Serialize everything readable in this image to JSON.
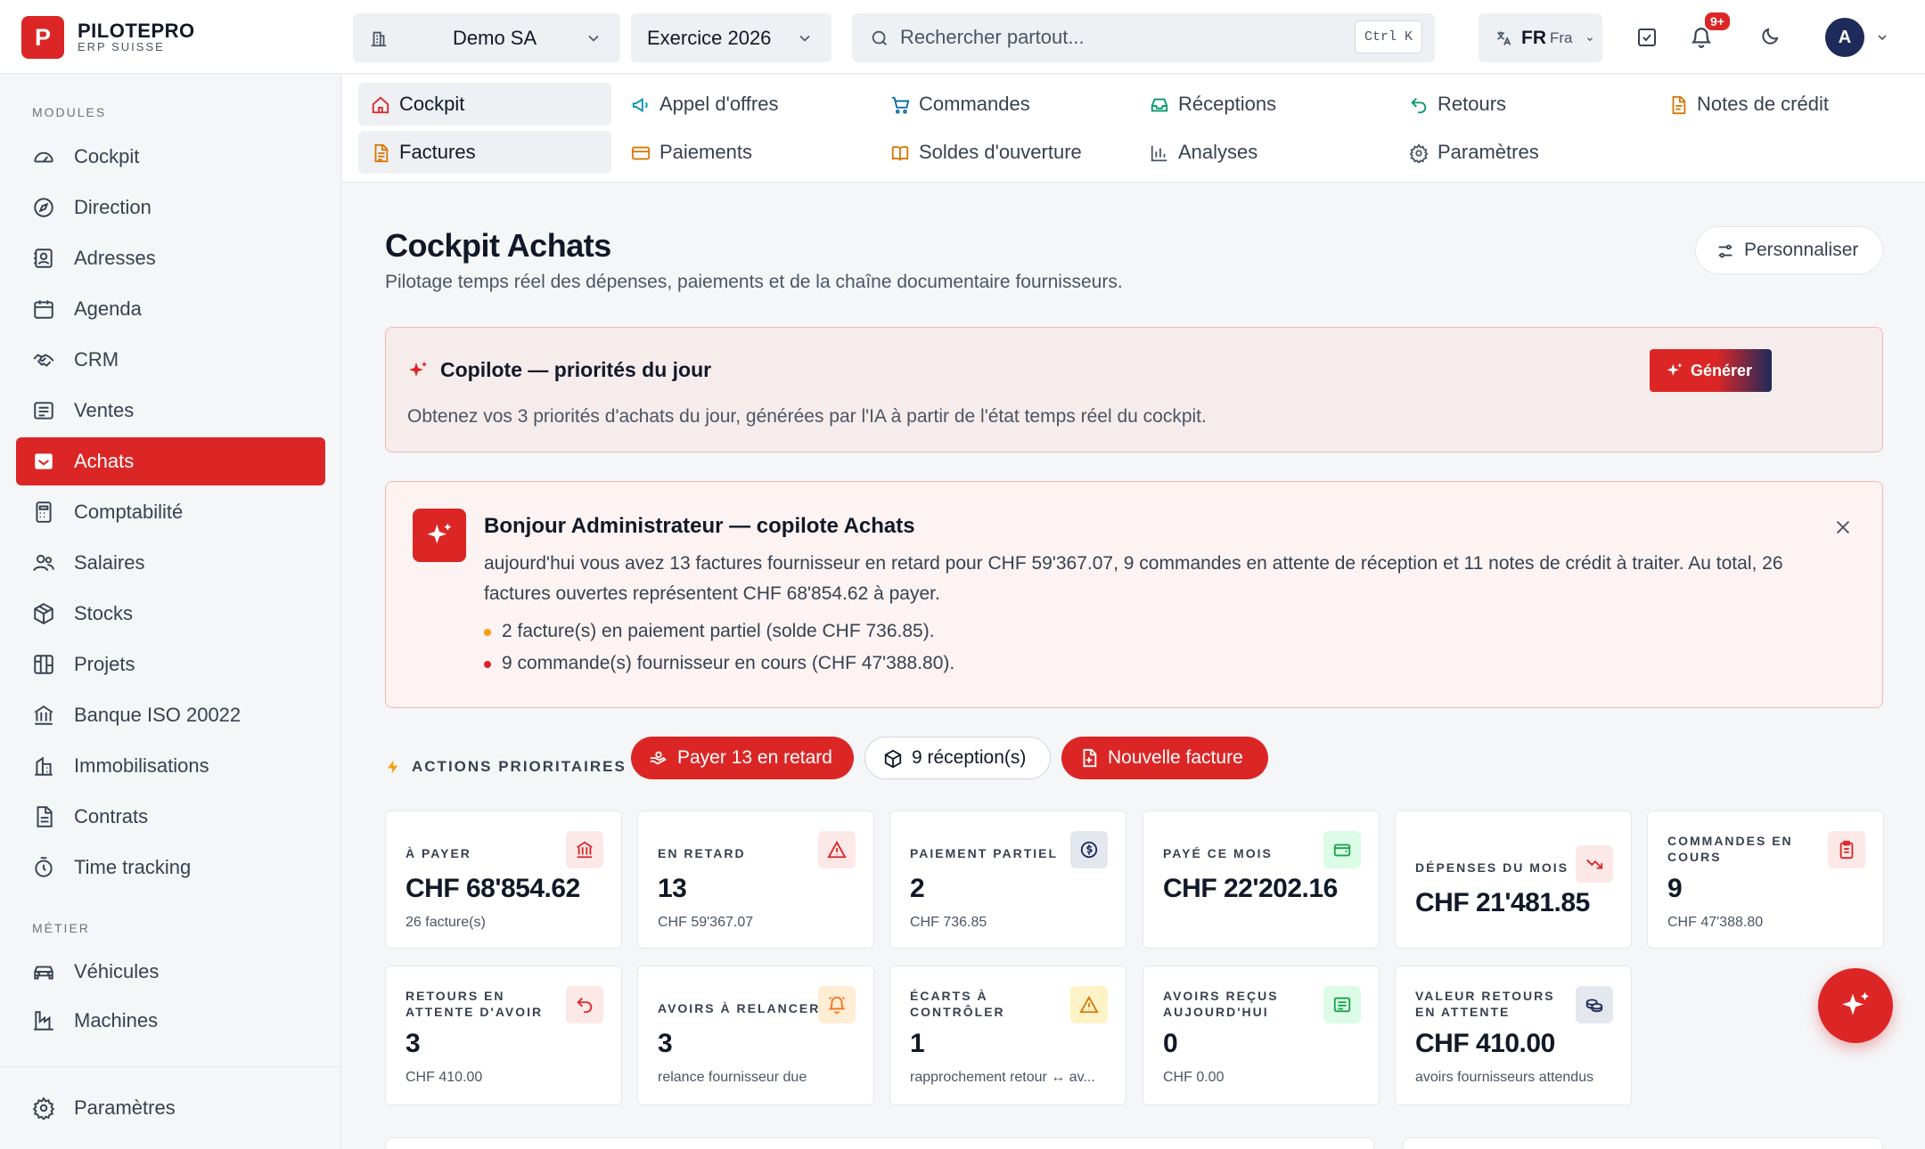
{
  "brand": {
    "name": "PILOTEPRO",
    "sub": "ERP SUISSE",
    "logo_letter": "P"
  },
  "header": {
    "company": "Demo SA",
    "fiscal_year": "Exercice 2026",
    "search_placeholder": "Rechercher partout...",
    "search_shortcut": "Ctrl K",
    "lang_code": "FR",
    "lang_name": "Fra",
    "notifications_badge": "9+",
    "avatar_initial": "A"
  },
  "sidebar": {
    "modules_title": "MODULES",
    "modules": [
      {
        "label": "Cockpit",
        "icon": "gauge-icon"
      },
      {
        "label": "Direction",
        "icon": "compass-icon"
      },
      {
        "label": "Adresses",
        "icon": "contact-icon"
      },
      {
        "label": "Agenda",
        "icon": "calendar-icon"
      },
      {
        "label": "CRM",
        "icon": "handshake-icon"
      },
      {
        "label": "Ventes",
        "icon": "receipt-icon"
      },
      {
        "label": "Achats",
        "icon": "inbox-icon",
        "active": true
      },
      {
        "label": "Comptabilité",
        "icon": "calculator-icon"
      },
      {
        "label": "Salaires",
        "icon": "users-icon"
      },
      {
        "label": "Stocks",
        "icon": "package-icon"
      },
      {
        "label": "Projets",
        "icon": "kanban-icon"
      },
      {
        "label": "Banque ISO 20022",
        "icon": "bank-icon"
      },
      {
        "label": "Immobilisations",
        "icon": "building-icon"
      },
      {
        "label": "Contrats",
        "icon": "file-icon"
      },
      {
        "label": "Time tracking",
        "icon": "timer-icon"
      }
    ],
    "metier_title": "MÉTIER",
    "metier": [
      {
        "label": "Véhicules",
        "icon": "car-icon"
      },
      {
        "label": "Machines",
        "icon": "factory-icon"
      }
    ],
    "settings": {
      "label": "Paramètres",
      "icon": "gear-icon"
    }
  },
  "subnav": [
    {
      "label": "Cockpit",
      "icon": "home-icon",
      "active": true
    },
    {
      "label": "Appel d'offres",
      "icon": "megaphone-icon"
    },
    {
      "label": "Commandes",
      "icon": "cart-icon"
    },
    {
      "label": "Réceptions",
      "icon": "tray-icon"
    },
    {
      "label": "Retours",
      "icon": "undo-icon"
    },
    {
      "label": "Notes de crédit",
      "icon": "note-icon"
    },
    {
      "label": "Factures",
      "icon": "invoice-icon",
      "active": true
    },
    {
      "label": "Paiements",
      "icon": "card-icon"
    },
    {
      "label": "Soldes d'ouverture",
      "icon": "book-icon"
    },
    {
      "label": "Analyses",
      "icon": "bars-icon"
    },
    {
      "label": "Paramètres",
      "icon": "gear-icon"
    }
  ],
  "page": {
    "title": "Cockpit Achats",
    "subtitle": "Pilotage temps réel des dépenses, paiements et de la chaîne documentaire fournisseurs.",
    "customize_label": "Personnaliser"
  },
  "copilot": {
    "title": "Copilote — priorités du jour",
    "description": "Obtenez vos 3 priorités d'achats du jour, générées par l'IA à partir de l'état temps réel du cockpit.",
    "generate_label": "Générer"
  },
  "greeting": {
    "title": "Bonjour Administrateur — copilote Achats",
    "body": "aujourd'hui vous avez 13 factures fournisseur en retard pour CHF 59'367.07, 9 commandes en attente de réception et 11 notes de crédit à traiter. Au total, 26 factures ouvertes représentent CHF 68'854.62 à payer.",
    "bullets": [
      {
        "text": "2 facture(s) en paiement partiel (solde CHF 736.85).",
        "color": "#f59e0b"
      },
      {
        "text": "9 commande(s) fournisseur en cours (CHF 47'388.80).",
        "color": "#dc2626"
      }
    ]
  },
  "actions": {
    "title": "ACTIONS PRIORITAIRES",
    "buttons": [
      {
        "label": "Payer 13 en retard",
        "style": "red",
        "icon": "cash-icon"
      },
      {
        "label": "9 réception(s)",
        "style": "white",
        "icon": "package-icon"
      },
      {
        "label": "Nouvelle facture",
        "style": "red",
        "icon": "file-plus-icon"
      }
    ]
  },
  "kpis": [
    {
      "label": "À PAYER",
      "value": "CHF 68'854.62",
      "sub": "26 facture(s)",
      "icon": "bank-icon",
      "tone": "#dc2626"
    },
    {
      "label": "EN RETARD",
      "value": "13",
      "sub": "CHF 59'367.07",
      "icon": "alert-icon",
      "tone": "#dc2626"
    },
    {
      "label": "PAIEMENT PARTIEL",
      "value": "2",
      "sub": "CHF 736.85",
      "icon": "coin-icon",
      "tone": "#1e2a5a"
    },
    {
      "label": "PAYÉ CE MOIS",
      "value": "CHF 22'202.16",
      "sub": "",
      "icon": "wallet-icon",
      "tone": "#16a34a"
    },
    {
      "label": "DÉPENSES DU MOIS",
      "value": "CHF 21'481.85",
      "sub": "",
      "icon": "trend-down-icon",
      "tone": "#dc2626"
    },
    {
      "label": "COMMANDES EN COURS",
      "value": "9",
      "sub": "CHF 47'388.80",
      "icon": "clipboard-icon",
      "tone": "#dc2626"
    },
    {
      "label": "RETOURS EN ATTENTE D'AVOIR",
      "value": "3",
      "sub": "CHF 410.00",
      "icon": "undo-icon",
      "tone": "#dc2626"
    },
    {
      "label": "AVOIRS À RELANCER",
      "value": "3",
      "sub": "relance fournisseur due",
      "icon": "bell-icon",
      "tone": "#f97316"
    },
    {
      "label": "ÉCARTS À CONTRÔLER",
      "value": "1",
      "sub": "rapprochement retour ↔ av...",
      "icon": "warning-icon",
      "tone": "#d97706"
    },
    {
      "label": "AVOIRS REÇUS AUJOURD'HUI",
      "value": "0",
      "sub": "CHF 0.00",
      "icon": "receipt-icon",
      "tone": "#16a34a"
    },
    {
      "label": "VALEUR RETOURS EN ATTENTE",
      "value": "CHF 410.00",
      "sub": "avoirs fournisseurs attendus",
      "icon": "coins-icon",
      "tone": "#1e2a5a"
    }
  ]
}
